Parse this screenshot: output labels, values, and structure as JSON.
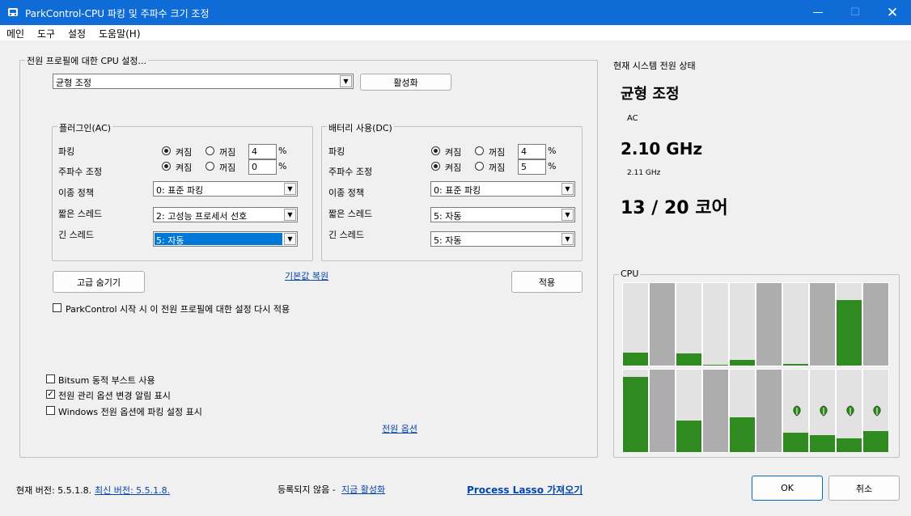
{
  "window": {
    "title": "ParkControl-CPU 파킹 및 주파수 크기 조정"
  },
  "menu": [
    "메인",
    "도구",
    "설정",
    "도움말(H)"
  ],
  "power_profile": {
    "group_label": "전원 프로필에 대한 CPU 설정...",
    "selected": "균형 조정",
    "activate_label": "활성화"
  },
  "ac": {
    "title": "플러그인(AC)",
    "parking_label": "파킹",
    "freq_label": "주파수 조정",
    "on_label": "켜짐",
    "off_label": "꺼짐",
    "parking_value": "4",
    "freq_value": "0",
    "percent": "%",
    "hetero_label": "이종 정책",
    "hetero_value": "0: 표준 파킹",
    "short_label": "짧은 스레드",
    "short_value": "2: 고성능 프로세서 선호",
    "long_label": "긴 스레드",
    "long_value": "5: 자동"
  },
  "dc": {
    "title": "배터리 사용(DC)",
    "parking_label": "파킹",
    "freq_label": "주파수 조정",
    "on_label": "켜짐",
    "off_label": "꺼짐",
    "parking_value": "4",
    "freq_value": "5",
    "percent": "%",
    "hetero_label": "이종 정책",
    "hetero_value": "0: 표준 파킹",
    "short_label": "짧은 스레드",
    "short_value": "5: 자동",
    "long_label": "긴 스레드",
    "long_value": "5: 자동"
  },
  "buttons": {
    "hide_advanced": "고급 숨기기",
    "restore_defaults": "기본값 복원",
    "apply": "적용",
    "ok": "OK",
    "cancel": "취소"
  },
  "options": {
    "reapply_startup": "ParkControl 시작 시 이 전원 프로필에 대한 설정 다시 적용",
    "bitsum_boost": "Bitsum 동적 부스트 사용",
    "notify_power_change": "전원 관리 옵션 변경 알림 표시",
    "show_in_windows": "Windows 전원 옵션에 파킹 설정 표시",
    "power_options_link": "전원 옵션"
  },
  "status": {
    "header": "현재 시스템 전원 상태",
    "plan": "균형 조정",
    "source": "AC",
    "frequency": "2.10 GHz",
    "frequency_detail": "2.11 GHz",
    "cores": "13 / 20 코어"
  },
  "cpu": {
    "label": "CPU",
    "bar_color": "#2f8a1f",
    "row1": [
      {
        "parked": false,
        "load": 0.16
      },
      {
        "parked": true,
        "load": 0.0
      },
      {
        "parked": false,
        "load": 0.15
      },
      {
        "parked": false,
        "load": 0.01
      },
      {
        "parked": false,
        "load": 0.07
      },
      {
        "parked": true,
        "load": 0.0
      },
      {
        "parked": false,
        "load": 0.02
      },
      {
        "parked": true,
        "load": 0.0
      },
      {
        "parked": false,
        "load": 0.79
      },
      {
        "parked": true,
        "load": 0.0
      }
    ],
    "row2": [
      {
        "parked": false,
        "load": 0.91,
        "leaf": false
      },
      {
        "parked": true,
        "load": 0.0,
        "leaf": false
      },
      {
        "parked": false,
        "load": 0.38,
        "leaf": false
      },
      {
        "parked": true,
        "load": 0.0,
        "leaf": false
      },
      {
        "parked": false,
        "load": 0.42,
        "leaf": false
      },
      {
        "parked": true,
        "load": 0.0,
        "leaf": false
      },
      {
        "parked": false,
        "load": 0.24,
        "leaf": true
      },
      {
        "parked": false,
        "load": 0.21,
        "leaf": true
      },
      {
        "parked": false,
        "load": 0.17,
        "leaf": true
      },
      {
        "parked": false,
        "load": 0.25,
        "leaf": true
      }
    ]
  },
  "footer": {
    "version_label": "현재 버전: 5.5.1.8.",
    "latest_link": "최신 버전: 5.5.1.8.",
    "unregistered": "등록되지 않음 -",
    "activate_now": "지금 활성화",
    "process_lasso": "Process Lasso 가져오기"
  }
}
